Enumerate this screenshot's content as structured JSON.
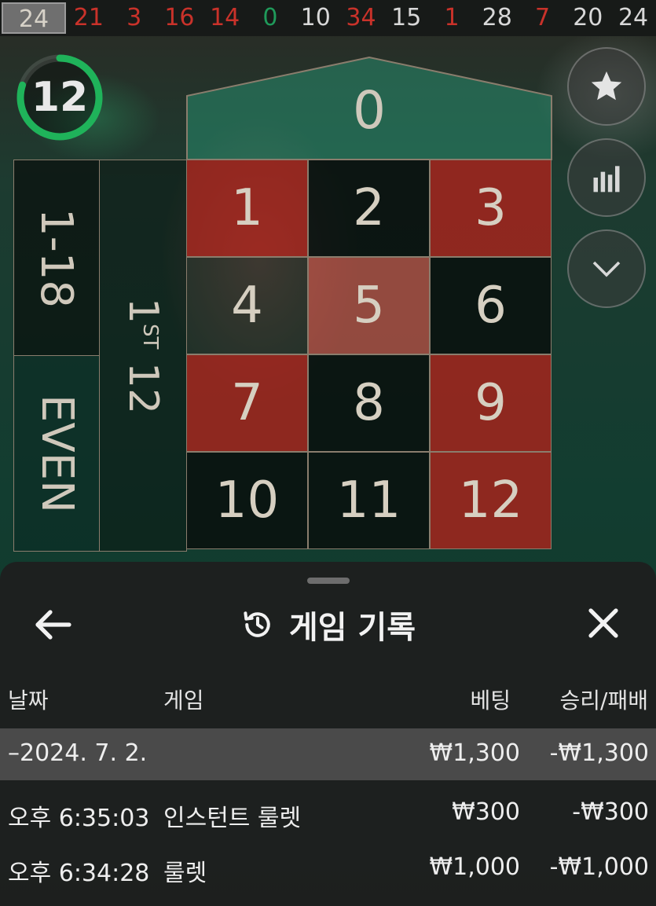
{
  "history": {
    "current": "24",
    "numbers": [
      {
        "value": "21",
        "color": "red"
      },
      {
        "value": "3",
        "color": "red"
      },
      {
        "value": "16",
        "color": "red"
      },
      {
        "value": "14",
        "color": "red"
      },
      {
        "value": "0",
        "color": "green"
      },
      {
        "value": "10",
        "color": "black"
      },
      {
        "value": "34",
        "color": "red"
      },
      {
        "value": "15",
        "color": "black"
      },
      {
        "value": "1",
        "color": "red"
      },
      {
        "value": "28",
        "color": "black"
      },
      {
        "value": "7",
        "color": "red"
      },
      {
        "value": "20",
        "color": "black"
      },
      {
        "value": "24",
        "color": "black"
      }
    ]
  },
  "timer": {
    "seconds": "12",
    "progress_fraction": 0.8,
    "color": "#1fb35a"
  },
  "table": {
    "zero": "0",
    "cells": [
      {
        "n": "1",
        "c": "red"
      },
      {
        "n": "2",
        "c": "black"
      },
      {
        "n": "3",
        "c": "red"
      },
      {
        "n": "4",
        "c": "black"
      },
      {
        "n": "5",
        "c": "red"
      },
      {
        "n": "6",
        "c": "black"
      },
      {
        "n": "7",
        "c": "red"
      },
      {
        "n": "8",
        "c": "black"
      },
      {
        "n": "9",
        "c": "red"
      },
      {
        "n": "10",
        "c": "black"
      },
      {
        "n": "11",
        "c": "black"
      },
      {
        "n": "12",
        "c": "red"
      }
    ],
    "range_low": "1-18",
    "even": "EVEN",
    "dozen_num": "1",
    "dozen_sup": "ST",
    "dozen_num2": "12"
  },
  "actions": {
    "favorite_icon": "star-icon",
    "stats_icon": "bar-chart-icon",
    "collapse_icon": "chevron-down-icon"
  },
  "sheet": {
    "title": "게임 기록",
    "columns": {
      "date": "날짜",
      "game": "게임",
      "bet": "베팅",
      "result": "승리/패배"
    },
    "date_group": {
      "date": "–2024. 7. 2.",
      "bet": "₩1,300",
      "result": "-₩1,300"
    },
    "rows": [
      {
        "time": "오후 6:35:03",
        "game": "인스턴트 룰렛",
        "bet": "₩300",
        "result": "-₩300"
      },
      {
        "time": "오후 6:34:28",
        "game": "룰렛",
        "bet": "₩1,000",
        "result": "-₩1,000"
      }
    ]
  },
  "colors": {
    "red": "#c9322a",
    "green": "#1fb35a",
    "sheet": "#1e1e1e"
  }
}
